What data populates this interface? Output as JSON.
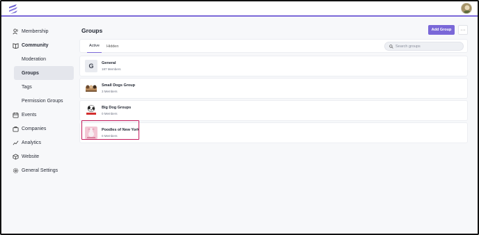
{
  "header": {
    "logo_icon": "brand-logo-icon",
    "avatar_icon": "user-avatar"
  },
  "sidebar": {
    "items": [
      {
        "label": "Membership",
        "icon": "members-icon"
      },
      {
        "label": "Community",
        "icon": "book-icon"
      },
      {
        "label": "Moderation"
      },
      {
        "label": "Groups"
      },
      {
        "label": "Tags"
      },
      {
        "label": "Permission Groups"
      },
      {
        "label": "Events",
        "icon": "calendar-icon"
      },
      {
        "label": "Companies",
        "icon": "briefcase-icon"
      },
      {
        "label": "Analytics",
        "icon": "analytics-icon"
      },
      {
        "label": "Website",
        "icon": "website-icon"
      },
      {
        "label": "General Settings",
        "icon": "gear-icon"
      }
    ],
    "active": "Groups"
  },
  "main": {
    "title": "Groups",
    "add_button": "Add Group",
    "more_button": "···",
    "tabs": [
      {
        "label": "Active"
      },
      {
        "label": "Hidden"
      }
    ],
    "search": {
      "placeholder": "Search groups",
      "value": ""
    },
    "groups": [
      {
        "name": "General",
        "members": "187 Members",
        "thumb_letter": "G"
      },
      {
        "name": "Small Dogs Group",
        "members": "3 Members"
      },
      {
        "name": "Big Dog Groups",
        "members": "0 Members"
      },
      {
        "name": "Poodles of New York",
        "members": "0 Members"
      }
    ]
  },
  "colors": {
    "accent": "#7a68d8",
    "highlight": "#c2185b"
  }
}
